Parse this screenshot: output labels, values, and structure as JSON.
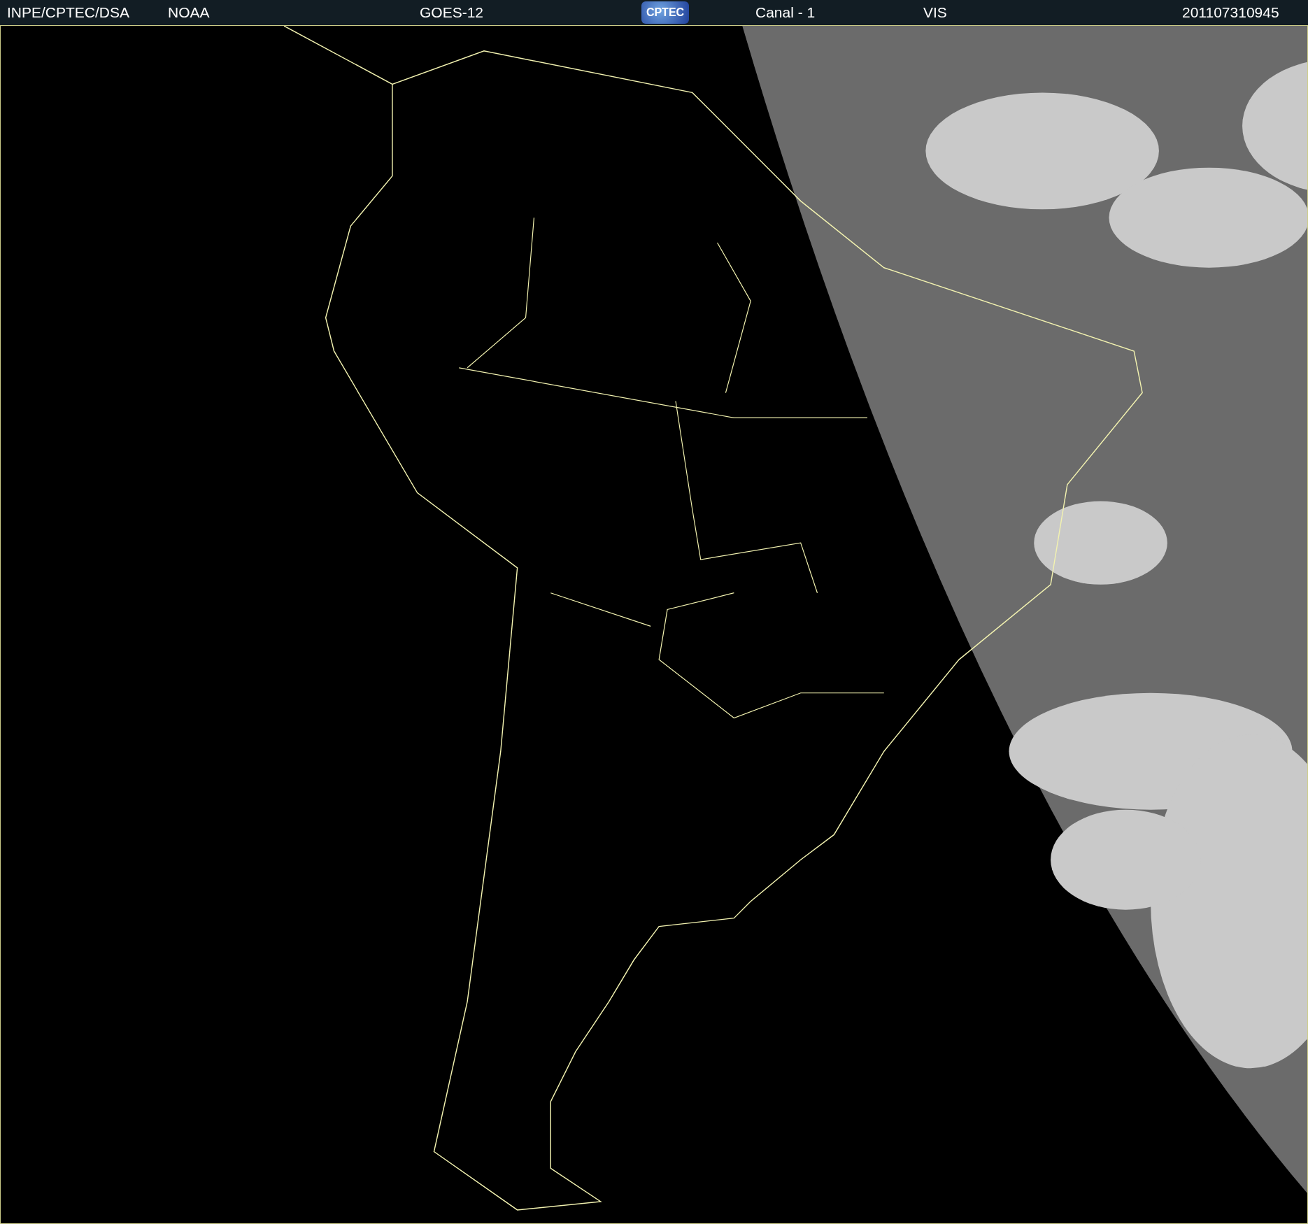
{
  "header": {
    "items": [
      {
        "kind": "text",
        "text": "INPE/CPTEC/DSA"
      },
      {
        "kind": "text",
        "text": "NOAA"
      },
      {
        "kind": "text",
        "text": "GOES-12"
      },
      {
        "kind": "logo",
        "text": "CPTEC"
      },
      {
        "kind": "text",
        "text": "Canal - 1"
      },
      {
        "kind": "text",
        "text": "VIS"
      },
      {
        "kind": "text",
        "text": "201107310945"
      }
    ]
  }
}
